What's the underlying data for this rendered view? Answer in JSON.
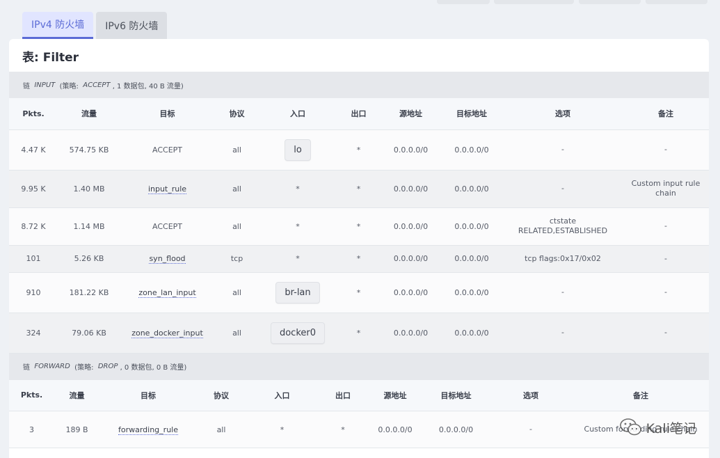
{
  "tabs": [
    {
      "label": "IPv4 防火墙",
      "active": true
    },
    {
      "label": "IPv6 防火墙",
      "active": false
    }
  ],
  "card_title": "表: Filter",
  "chains": [
    {
      "prefix": "链",
      "name": "INPUT",
      "policy_label": "(策略:",
      "policy": "ACCEPT",
      "stats": ", 1 数据包, 40 B 流量)",
      "headers": [
        "Pkts.",
        "流量",
        "目标",
        "协议",
        "入口",
        "出口",
        "源地址",
        "目标地址",
        "选项",
        "备注"
      ],
      "rows": [
        {
          "pkts": "4.47 K",
          "traffic": "574.75 KB",
          "target": "ACCEPT",
          "target_link": false,
          "proto": "all",
          "in": "lo",
          "in_iface": true,
          "out": "*",
          "src": "0.0.0.0/0",
          "dst": "0.0.0.0/0",
          "opts": "-",
          "comment": "-"
        },
        {
          "pkts": "9.95 K",
          "traffic": "1.40 MB",
          "target": "input_rule",
          "target_link": true,
          "proto": "all",
          "in": "*",
          "in_iface": false,
          "out": "*",
          "src": "0.0.0.0/0",
          "dst": "0.0.0.0/0",
          "opts": "-",
          "comment": "Custom input rule chain"
        },
        {
          "pkts": "8.72 K",
          "traffic": "1.14 MB",
          "target": "ACCEPT",
          "target_link": false,
          "proto": "all",
          "in": "*",
          "in_iface": false,
          "out": "*",
          "src": "0.0.0.0/0",
          "dst": "0.0.0.0/0",
          "opts": "ctstate RELATED,ESTABLISHED",
          "comment": "-"
        },
        {
          "pkts": "101",
          "traffic": "5.26 KB",
          "target": "syn_flood",
          "target_link": true,
          "proto": "tcp",
          "in": "*",
          "in_iface": false,
          "out": "*",
          "src": "0.0.0.0/0",
          "dst": "0.0.0.0/0",
          "opts": "tcp flags:0x17/0x02",
          "comment": "-"
        },
        {
          "pkts": "910",
          "traffic": "181.22 KB",
          "target": "zone_lan_input",
          "target_link": true,
          "proto": "all",
          "in": "br-lan",
          "in_iface": true,
          "out": "*",
          "src": "0.0.0.0/0",
          "dst": "0.0.0.0/0",
          "opts": "-",
          "comment": "-"
        },
        {
          "pkts": "324",
          "traffic": "79.06 KB",
          "target": "zone_docker_input",
          "target_link": true,
          "proto": "all",
          "in": "docker0",
          "in_iface": true,
          "out": "*",
          "src": "0.0.0.0/0",
          "dst": "0.0.0.0/0",
          "opts": "-",
          "comment": "-"
        }
      ]
    },
    {
      "prefix": "链",
      "name": "FORWARD",
      "policy_label": "(策略:",
      "policy": "DROP",
      "stats": ", 0 数据包, 0 B 流量)",
      "headers": [
        "Pkts.",
        "流量",
        "目标",
        "协议",
        "入口",
        "出口",
        "源地址",
        "目标地址",
        "选项",
        "备注"
      ],
      "rows": [
        {
          "pkts": "3",
          "traffic": "189 B",
          "target": "forwarding_rule",
          "target_link": true,
          "proto": "all",
          "in": "*",
          "in_iface": false,
          "out": "*",
          "src": "0.0.0.0/0",
          "dst": "0.0.0.0/0",
          "opts": "-",
          "comment": "Custom forwarding rule chain"
        }
      ]
    }
  ],
  "watermark": {
    "text": "Kali笔记",
    "icon": "wechat-icon"
  }
}
